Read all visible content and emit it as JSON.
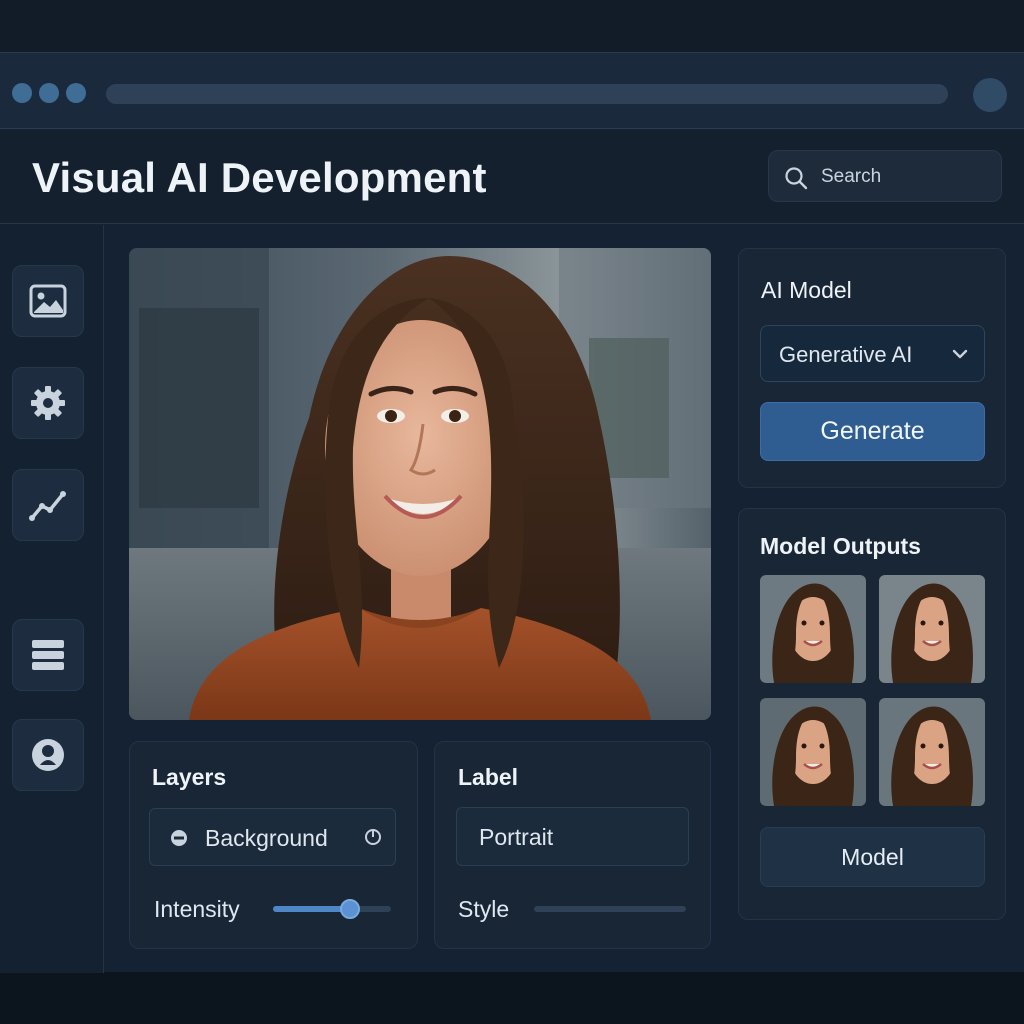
{
  "header": {
    "title": "Visual AI Development"
  },
  "search": {
    "label": "Search",
    "icon": "search-icon"
  },
  "sidebar": {
    "items": [
      {
        "icon": "image-icon"
      },
      {
        "icon": "gear-icon"
      },
      {
        "icon": "line-chart-icon"
      },
      {
        "icon": "database-icon"
      },
      {
        "icon": "user-icon"
      }
    ]
  },
  "ai_model": {
    "title": "AI Model",
    "selected": "Generative AI",
    "generate_label": "Generate"
  },
  "outputs": {
    "title": "Model Outputs",
    "thumbnail_count": 4,
    "model_button_label": "Model"
  },
  "layers": {
    "title": "Layers",
    "layer_name": "Background",
    "intensity_label": "Intensity",
    "intensity_value": 0.65
  },
  "label_panel": {
    "title": "Label",
    "value": "Portrait",
    "style_label": "Style",
    "style_value": 0
  },
  "colors": {
    "accent": "#2f5d92",
    "background": "#142233",
    "panel": "#182636",
    "sweater": "#9a4a22"
  }
}
